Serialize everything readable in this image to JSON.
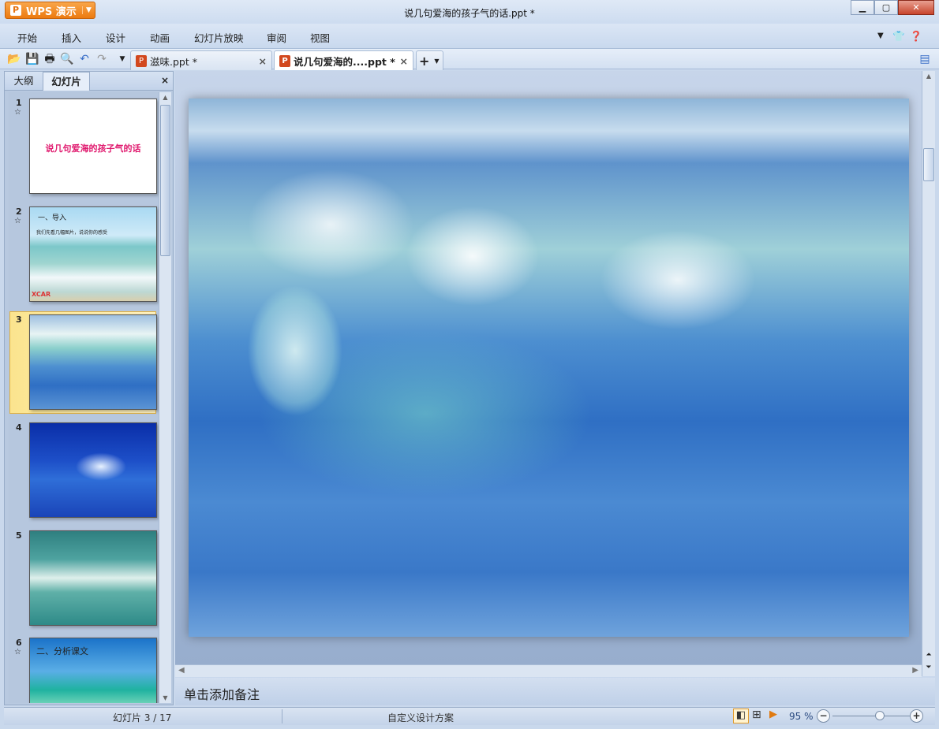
{
  "app": {
    "name": "WPS 演示",
    "title": "说几句爱海的孩子气的话.ppt *"
  },
  "menu": [
    "开始",
    "插入",
    "设计",
    "动画",
    "幻灯片放映",
    "审阅",
    "视图"
  ],
  "doc_tabs": [
    {
      "label": "滋味.ppt *",
      "active": false
    },
    {
      "label": "说几句爱海的....ppt *",
      "active": true
    }
  ],
  "panel": {
    "tabs": [
      "大纲",
      "幻灯片"
    ],
    "active_tab": "幻灯片"
  },
  "slides": [
    {
      "num": "1",
      "title": "说几句爱海的孩子气的话"
    },
    {
      "num": "2",
      "title": "一、导入",
      "bullet": "我们先看几幅图片，说说你的感受",
      "logo": "XCAR"
    },
    {
      "num": "3"
    },
    {
      "num": "4"
    },
    {
      "num": "5"
    },
    {
      "num": "6",
      "title": "二、分析课文"
    }
  ],
  "selected_slide": 3,
  "notes_placeholder": "单击添加备注",
  "status": {
    "slide_info": "幻灯片 3 / 17",
    "design": "自定义设计方案",
    "zoom": "95 %",
    "zoom_percent": 95
  }
}
